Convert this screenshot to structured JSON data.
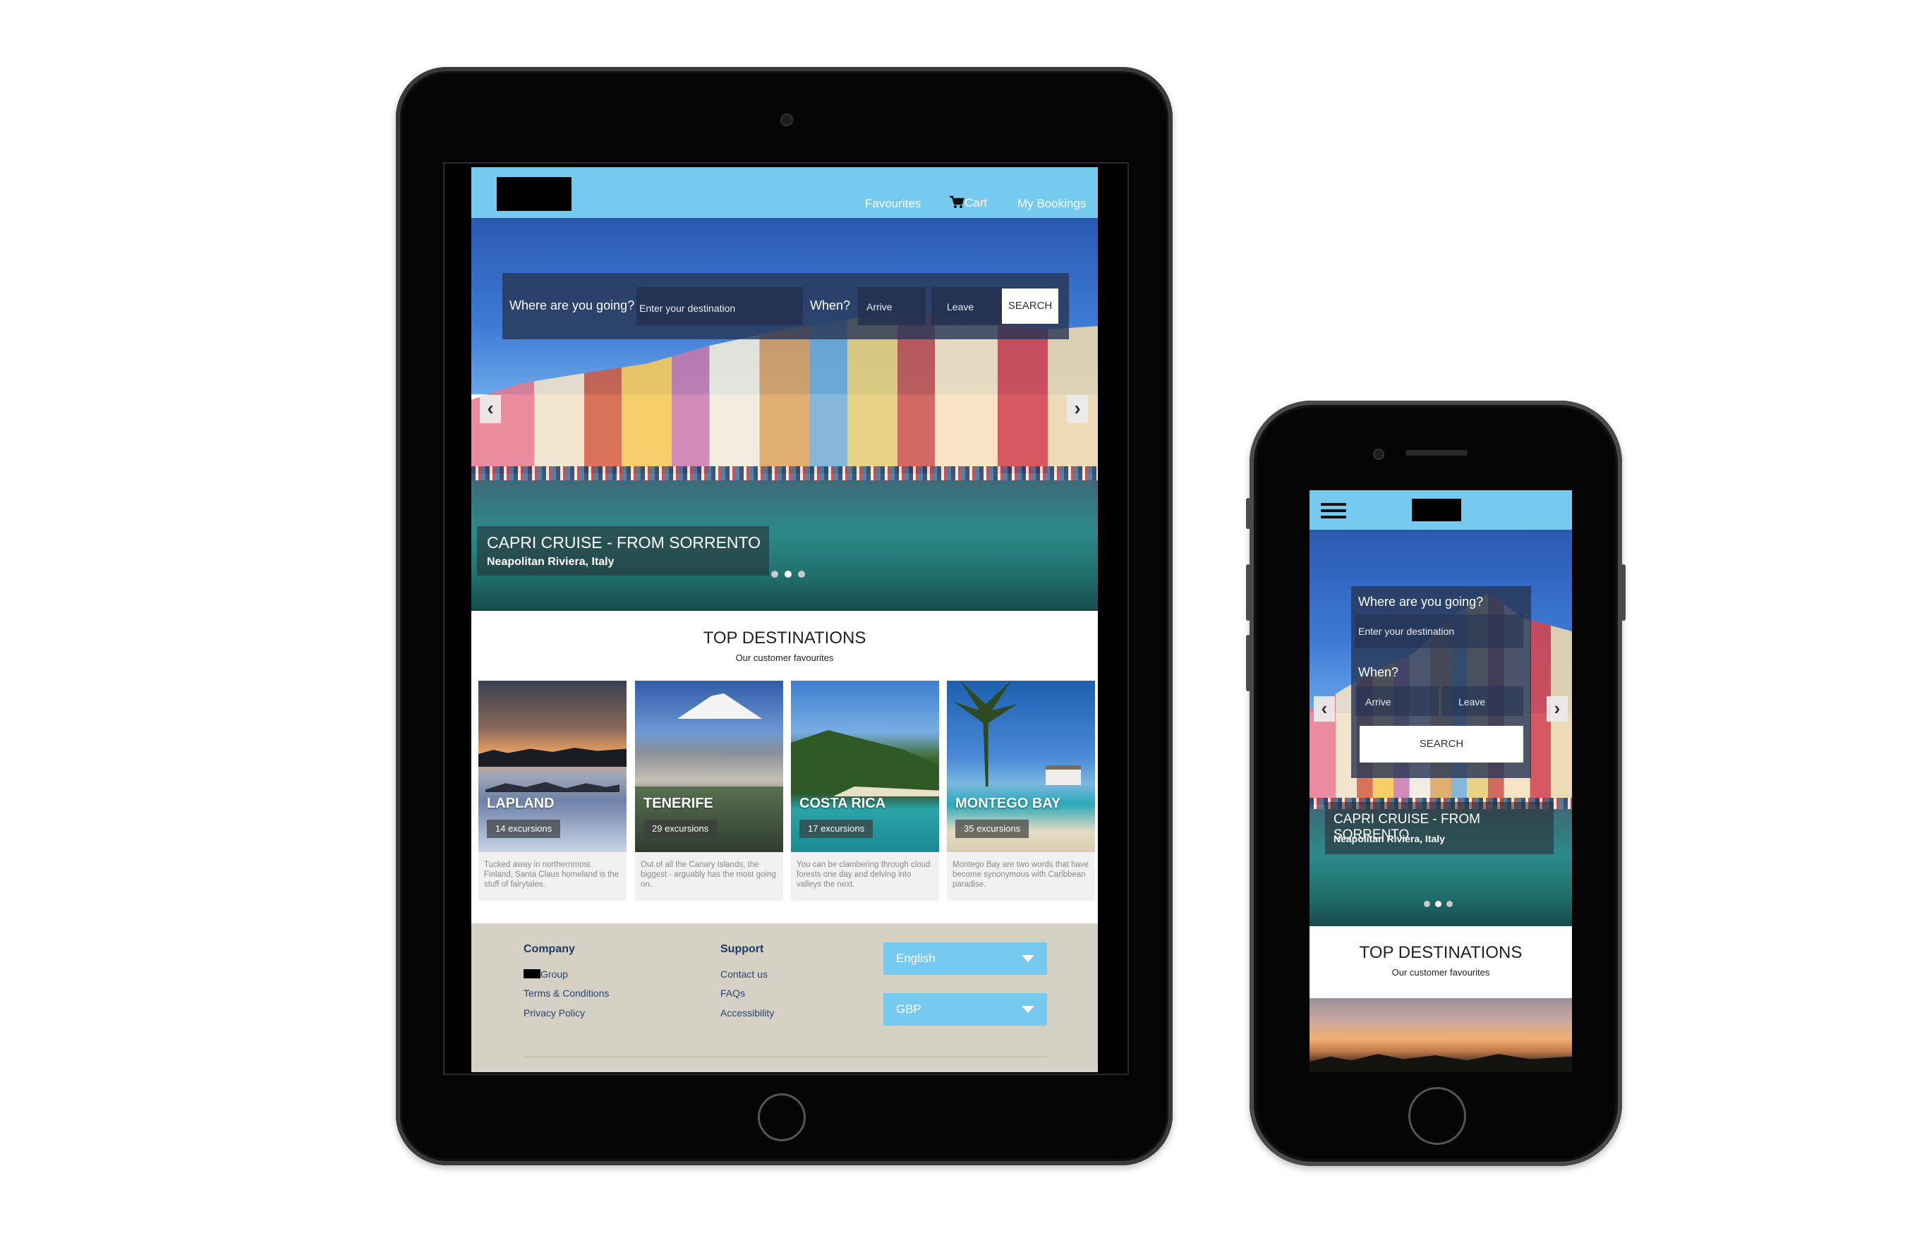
{
  "brand": {
    "accent": "#76c9ef",
    "footer_bg": "#d5d1c4",
    "dark": "#050505"
  },
  "tablet": {
    "nav": {
      "favourites": "Favourites",
      "cart": "Cart",
      "bookings": "My Bookings",
      "cart_icon": "cart-icon"
    },
    "search": {
      "where_label": "Where are you going?",
      "destination_placeholder": "Enter your destination",
      "when_label": "When?",
      "arrive_placeholder": "Arrive",
      "leave_placeholder": "Leave",
      "button": "SEARCH"
    },
    "hero": {
      "title": "CAPRI CRUISE - FROM SORRENTO",
      "subtitle": "Neapolitan Riviera, Italy",
      "prev": "‹",
      "next": "›"
    },
    "section": {
      "title": "TOP DESTINATIONS",
      "subtitle": "Our customer favourites"
    },
    "destinations": [
      {
        "name": "LAPLAND",
        "count": "14 excursions",
        "desc": "Tucked away in northernmost Finland, Santa Claus homeland is the stuff of fairytales."
      },
      {
        "name": "TENERIFE",
        "count": "29 excursions",
        "desc": "Out of all the Canary Islands, the biggest - arguably has the most going on."
      },
      {
        "name": "COSTA RICA",
        "count": "17 excursions",
        "desc": "You can be clambering through cloud forests one day and delving into valleys the next."
      },
      {
        "name": "MONTEGO BAY",
        "count": "35 excursions",
        "desc": "Montego Bay are two words that have become synonymous with Caribbean paradise."
      }
    ],
    "footer": {
      "company_heading": "Company",
      "company_links": [
        "Group",
        "Terms & Conditions",
        "Privacy Policy"
      ],
      "support_heading": "Support",
      "support_links": [
        "Contact us",
        "FAQs",
        "Accessibility"
      ],
      "language": "English",
      "currency": "GBP"
    }
  },
  "phone": {
    "search": {
      "where_label": "Where are you going?",
      "destination_placeholder": "Enter your destination",
      "when_label": "When?",
      "arrive_placeholder": "Arrive",
      "leave_placeholder": "Leave",
      "button": "SEARCH"
    },
    "hero": {
      "title": "CAPRI CRUISE - FROM SORRENTO",
      "subtitle": "Neapolitan Riviera, Italy",
      "prev": "‹",
      "next": "›"
    },
    "section": {
      "title": "TOP DESTINATIONS",
      "subtitle": "Our customer favourites"
    }
  }
}
